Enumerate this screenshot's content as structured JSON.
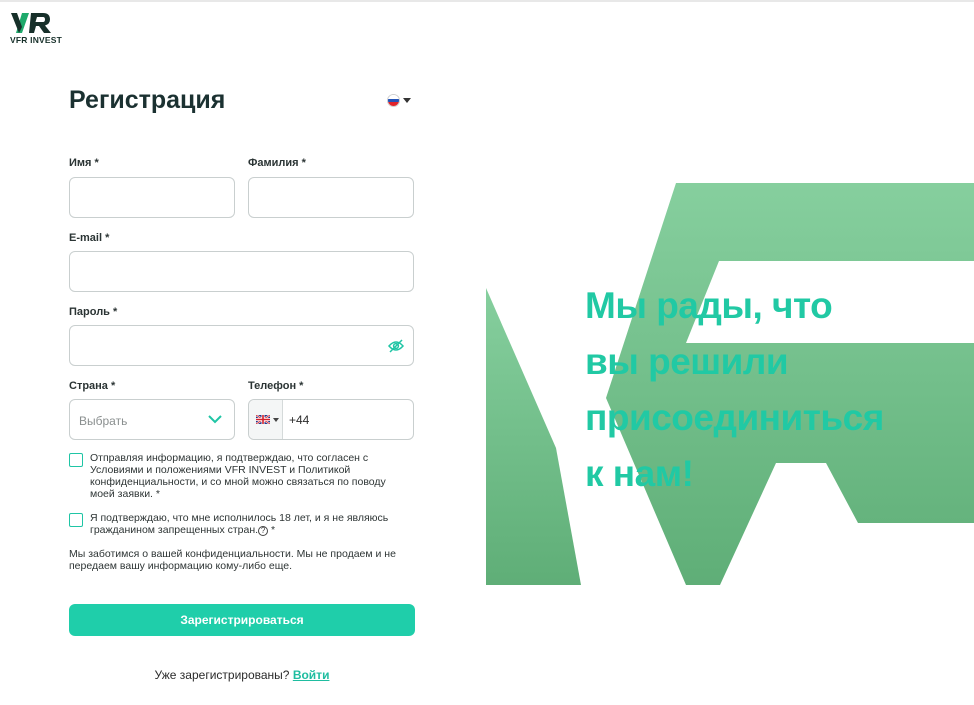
{
  "brand": {
    "logo_mark": "VR",
    "name": "VFR INVEST"
  },
  "form": {
    "title": "Регистрация",
    "language_flag": "russia-flag-icon",
    "first_name_label": "Имя *",
    "last_name_label": "Фамилия *",
    "email_label": "E-mail *",
    "password_label": "Пароль *",
    "country_label": "Страна *",
    "phone_label": "Телефон *",
    "country_placeholder": "Выбрать",
    "phone_code": "+44",
    "consent_text": "Отправляя информацию, я подтверждаю, что согласен с Условиями и положениями VFR INVEST и Политикой конфиденциальности, и со мной можно связаться по поводу моей заявки. *",
    "age_text": "Я подтверждаю, что мне исполнилось 18 лет, и я не являюсь гражданином запрещенных стран.",
    "age_suffix": " *",
    "help_glyph": "?",
    "privacy_note": "Мы заботимся о вашей конфиденциальности. Мы не продаем и не передаем вашу информацию кому-либо еще.",
    "submit_label": "Зарегистрироваться",
    "already_registered": "Уже зарегистрированы?",
    "login_link": "Войти"
  },
  "hero": {
    "lines": [
      "Мы рады, что",
      "вы решили",
      "присоединиться",
      "к нам!"
    ]
  },
  "colors": {
    "accent": "#1fceaa",
    "hero_green_light": "#86cf9e",
    "hero_green_dark": "#5fae77"
  }
}
